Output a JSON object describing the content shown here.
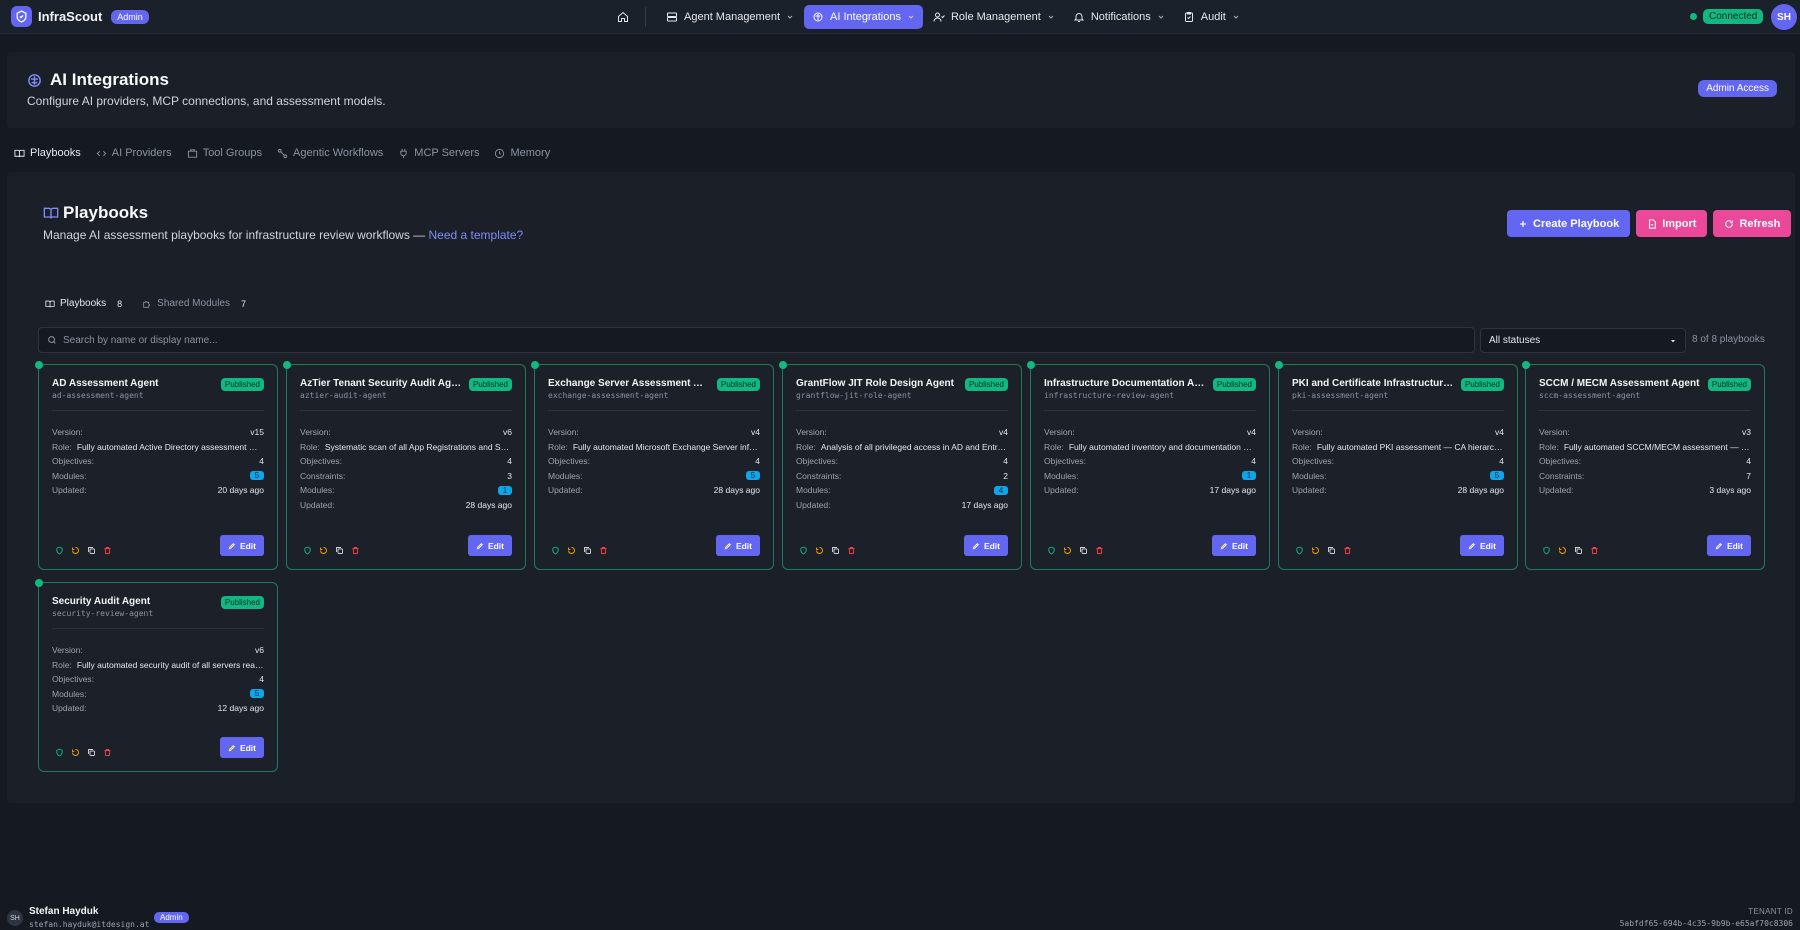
{
  "app": {
    "name": "InfraScout",
    "role_badge": "Admin"
  },
  "nav": {
    "items": [
      {
        "label": "Agent Management"
      },
      {
        "label": "AI Integrations"
      },
      {
        "label": "Role Management"
      },
      {
        "label": "Notifications"
      },
      {
        "label": "Audit"
      }
    ],
    "status": "Connected",
    "avatar": "SH"
  },
  "page": {
    "title": "AI Integrations",
    "subtitle": "Configure AI providers, MCP connections, and assessment models.",
    "access_badge": "Admin Access"
  },
  "tabs": [
    {
      "label": "Playbooks"
    },
    {
      "label": "AI Providers"
    },
    {
      "label": "Tool Groups"
    },
    {
      "label": "Agentic Workflows"
    },
    {
      "label": "MCP Servers"
    },
    {
      "label": "Memory"
    }
  ],
  "playbooks": {
    "title": "Playbooks",
    "subtitle": "Manage AI assessment playbooks for infrastructure review workflows — ",
    "template_link": "Need a template?",
    "create_label": "Create Playbook",
    "import_label": "Import",
    "refresh_label": "Refresh",
    "subtabs": [
      {
        "label": "Playbooks",
        "count": "8"
      },
      {
        "label": "Shared Modules",
        "count": "7"
      }
    ],
    "search_placeholder": "Search by name or display name...",
    "status_filter": "All statuses",
    "count_text": "8 of 8 playbooks",
    "labels": {
      "version": "Version:",
      "role": "Role:",
      "objectives": "Objectives:",
      "constraints": "Constraints:",
      "modules": "Modules:",
      "updated": "Updated:",
      "edit": "Edit",
      "published": "Published"
    },
    "cards": [
      {
        "name": "AD Assessment Agent",
        "slug": "ad-assessment-agent",
        "version": "v15",
        "role": "Fully automated Active Directory assessment — t...",
        "objectives": "4",
        "constraints": null,
        "modules": "5",
        "updated": "20 days ago"
      },
      {
        "name": "AzTier Tenant Security Audit Agent",
        "slug": "aztier-audit-agent",
        "version": "v6",
        "role": "Systematic scan of all App Registrations and Ser...",
        "objectives": "4",
        "constraints": "3",
        "modules": "1",
        "updated": "28 days ago"
      },
      {
        "name": "Exchange Server Assessment Ag...",
        "slug": "exchange-assessment-agent",
        "version": "v4",
        "role": "Fully automated Microsoft Exchange Server infra...",
        "objectives": "4",
        "constraints": null,
        "modules": "5",
        "updated": "28 days ago"
      },
      {
        "name": "GrantFlow JIT Role Design Agent",
        "slug": "grantflow-jit-role-agent",
        "version": "v4",
        "role": "Analysis of all privileged access in AD and Entra I...",
        "objectives": "4",
        "constraints": "2",
        "modules": "4",
        "updated": "17 days ago"
      },
      {
        "name": "Infrastructure Documentation Ag...",
        "slug": "infrastructure-review-agent",
        "version": "v4",
        "role": "Fully automated inventory and documentation of ...",
        "objectives": "4",
        "constraints": null,
        "modules": "1",
        "updated": "17 days ago"
      },
      {
        "name": "PKI and Certificate Infrastructure ...",
        "slug": "pki-assessment-agent",
        "version": "v4",
        "role": "Fully automated PKI assessment — CA hierarchy,...",
        "objectives": "4",
        "constraints": null,
        "modules": "5",
        "updated": "28 days ago"
      },
      {
        "name": "SCCM / MECM Assessment Agent",
        "slug": "sccm-assessment-agent",
        "version": "v3",
        "role": "Fully automated SCCM/MECM assessment — sit...",
        "objectives": "4",
        "constraints": "7",
        "modules": null,
        "updated": "3 days ago"
      },
      {
        "name": "Security Audit Agent",
        "slug": "security-review-agent",
        "version": "v6",
        "role": "Fully automated security audit of all servers reac...",
        "objectives": "4",
        "constraints": null,
        "modules": "5",
        "updated": "12 days ago"
      }
    ]
  },
  "footer": {
    "avatar": "SH",
    "name": "Stefan Hayduk",
    "email": "stefan.hayduk@itdesign.at",
    "badge": "Admin",
    "tenant_label": "TENANT ID",
    "tenant_id": "5abfdf65-694b-4c35-9b9b-e65af70c8306"
  },
  "colors": {
    "accent": "#6366f1",
    "success": "#10b981",
    "pink": "#ec4899",
    "info": "#0ea5e9"
  }
}
